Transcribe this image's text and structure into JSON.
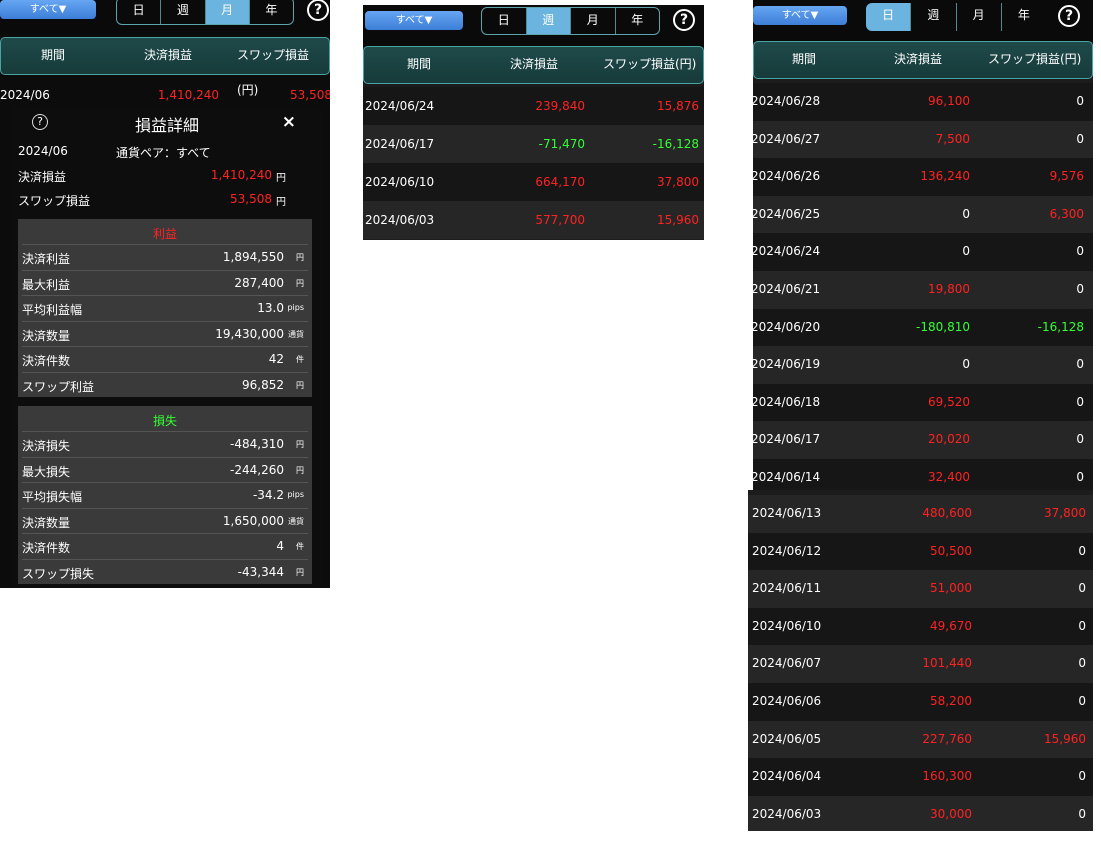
{
  "controls": {
    "all_label": "すべて▼",
    "segments": [
      "日",
      "週",
      "月",
      "年"
    ],
    "help": "?"
  },
  "columns": {
    "period": "期間",
    "pl": "決済損益",
    "swap": "スワップ損益(円)"
  },
  "monthly": {
    "active_segment": "月",
    "row": {
      "date": "2024/06",
      "pl": "1,410,240",
      "swap": "53,508"
    }
  },
  "detail": {
    "title": "損益詳細",
    "close": "×",
    "help": "?",
    "period": "2024/06",
    "pair_label": "通貨ペア：すべて",
    "settle_label": "決済損益",
    "settle_value": "1,410,240",
    "swap_label": "スワップ損益",
    "swap_value": "53,508",
    "yen": "円",
    "profit": {
      "heading": "利益",
      "rows": [
        {
          "label": "決済利益",
          "value": "1,894,550",
          "unit": "円"
        },
        {
          "label": "最大利益",
          "value": "287,400",
          "unit": "円"
        },
        {
          "label": "平均利益幅",
          "value": "13.0",
          "unit": "pips"
        },
        {
          "label": "決済数量",
          "value": "19,430,000",
          "unit": "通貨"
        },
        {
          "label": "決済件数",
          "value": "42",
          "unit": "件"
        },
        {
          "label": "スワップ利益",
          "value": "96,852",
          "unit": "円"
        }
      ]
    },
    "loss": {
      "heading": "損失",
      "rows": [
        {
          "label": "決済損失",
          "value": "-484,310",
          "unit": "円"
        },
        {
          "label": "最大損失",
          "value": "-244,260",
          "unit": "円"
        },
        {
          "label": "平均損失幅",
          "value": "-34.2",
          "unit": "pips"
        },
        {
          "label": "決済数量",
          "value": "1,650,000",
          "unit": "通貨"
        },
        {
          "label": "決済件数",
          "value": "4",
          "unit": "件"
        },
        {
          "label": "スワップ損失",
          "value": "-43,344",
          "unit": "円"
        }
      ]
    }
  },
  "weekly": {
    "active_segment": "週",
    "rows": [
      {
        "date": "2024/06/24",
        "pl": "239,840",
        "swap": "15,876",
        "pl_color": "red",
        "swap_color": "red"
      },
      {
        "date": "2024/06/17",
        "pl": "-71,470",
        "swap": "-16,128",
        "pl_color": "green",
        "swap_color": "green"
      },
      {
        "date": "2024/06/10",
        "pl": "664,170",
        "swap": "37,800",
        "pl_color": "red",
        "swap_color": "red"
      },
      {
        "date": "2024/06/03",
        "pl": "577,700",
        "swap": "15,960",
        "pl_color": "red",
        "swap_color": "red"
      }
    ]
  },
  "daily": {
    "active_segment": "日",
    "rows_top": [
      {
        "date": "2024/06/28",
        "pl": "96,100",
        "swap": "0",
        "pl_color": "red",
        "swap_color": "white"
      },
      {
        "date": "2024/06/27",
        "pl": "7,500",
        "swap": "0",
        "pl_color": "red",
        "swap_color": "white"
      },
      {
        "date": "2024/06/26",
        "pl": "136,240",
        "swap": "9,576",
        "pl_color": "red",
        "swap_color": "red"
      },
      {
        "date": "2024/06/25",
        "pl": "0",
        "swap": "6,300",
        "pl_color": "white",
        "swap_color": "red"
      },
      {
        "date": "2024/06/24",
        "pl": "0",
        "swap": "0",
        "pl_color": "white",
        "swap_color": "white"
      },
      {
        "date": "2024/06/21",
        "pl": "19,800",
        "swap": "0",
        "pl_color": "red",
        "swap_color": "white"
      },
      {
        "date": "2024/06/20",
        "pl": "-180,810",
        "swap": "-16,128",
        "pl_color": "green",
        "swap_color": "green"
      },
      {
        "date": "2024/06/19",
        "pl": "0",
        "swap": "0",
        "pl_color": "white",
        "swap_color": "white"
      },
      {
        "date": "2024/06/18",
        "pl": "69,520",
        "swap": "0",
        "pl_color": "red",
        "swap_color": "white"
      },
      {
        "date": "2024/06/17",
        "pl": "20,020",
        "swap": "0",
        "pl_color": "red",
        "swap_color": "white"
      },
      {
        "date": "2024/06/14",
        "pl": "32,400",
        "swap": "0",
        "pl_color": "red",
        "swap_color": "white"
      }
    ],
    "rows_bottom": [
      {
        "date": "2024/06/13",
        "pl": "480,600",
        "swap": "37,800",
        "pl_color": "red",
        "swap_color": "red"
      },
      {
        "date": "2024/06/12",
        "pl": "50,500",
        "swap": "0",
        "pl_color": "red",
        "swap_color": "white"
      },
      {
        "date": "2024/06/11",
        "pl": "51,000",
        "swap": "0",
        "pl_color": "red",
        "swap_color": "white"
      },
      {
        "date": "2024/06/10",
        "pl": "49,670",
        "swap": "0",
        "pl_color": "red",
        "swap_color": "white"
      },
      {
        "date": "2024/06/07",
        "pl": "101,440",
        "swap": "0",
        "pl_color": "red",
        "swap_color": "white"
      },
      {
        "date": "2024/06/06",
        "pl": "58,200",
        "swap": "0",
        "pl_color": "red",
        "swap_color": "white"
      },
      {
        "date": "2024/06/05",
        "pl": "227,760",
        "swap": "15,960",
        "pl_color": "red",
        "swap_color": "red"
      },
      {
        "date": "2024/06/04",
        "pl": "160,300",
        "swap": "0",
        "pl_color": "red",
        "swap_color": "white"
      },
      {
        "date": "2024/06/03",
        "pl": "30,000",
        "swap": "0",
        "pl_color": "red",
        "swap_color": "white"
      }
    ]
  },
  "colors": {
    "profit": "#ff2222",
    "loss": "#33ff33",
    "header": "#1f4a4a",
    "accent": "#6bb4e0"
  }
}
